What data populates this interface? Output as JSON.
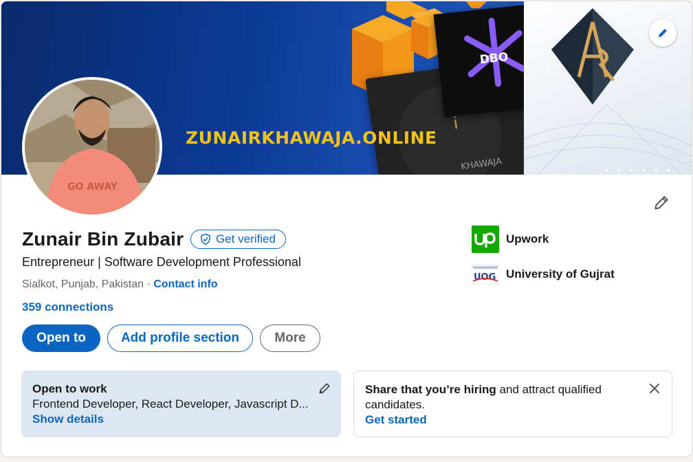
{
  "banner": {
    "website_text": "ZUNAIRKHAWAJA.ONLINE",
    "dbo_text": "DBO",
    "card_text": "KHAWAJA",
    "edit_icon": "pencil-icon"
  },
  "profile": {
    "name": "Zunair Bin Zubair",
    "verified_label": "Get verified",
    "headline": "Entrepreneur | Software Development Professional",
    "location": "Sialkot, Punjab, Pakistan",
    "separator": " · ",
    "contact_info_label": "Contact info",
    "connections": "359 connections",
    "avatar_shirt_text": "GO AWAY"
  },
  "actions": {
    "open_to": "Open to",
    "add_section": "Add profile section",
    "more": "More"
  },
  "orgs": [
    {
      "name": "Upwork",
      "logo": "upwork-logo"
    },
    {
      "name": "University of Gujrat",
      "logo": "uog-logo"
    }
  ],
  "open_to_work": {
    "title": "Open to work",
    "roles": "Frontend Developer, React Developer, Javascript D...",
    "link": "Show details"
  },
  "hiring": {
    "title": "Share that you’re hiring",
    "rest": " and attract qualified candidates.",
    "link": "Get started"
  },
  "colors": {
    "primary": "#0a66c2",
    "upwork": "#14a800",
    "banner_text": "#f1c21b"
  }
}
